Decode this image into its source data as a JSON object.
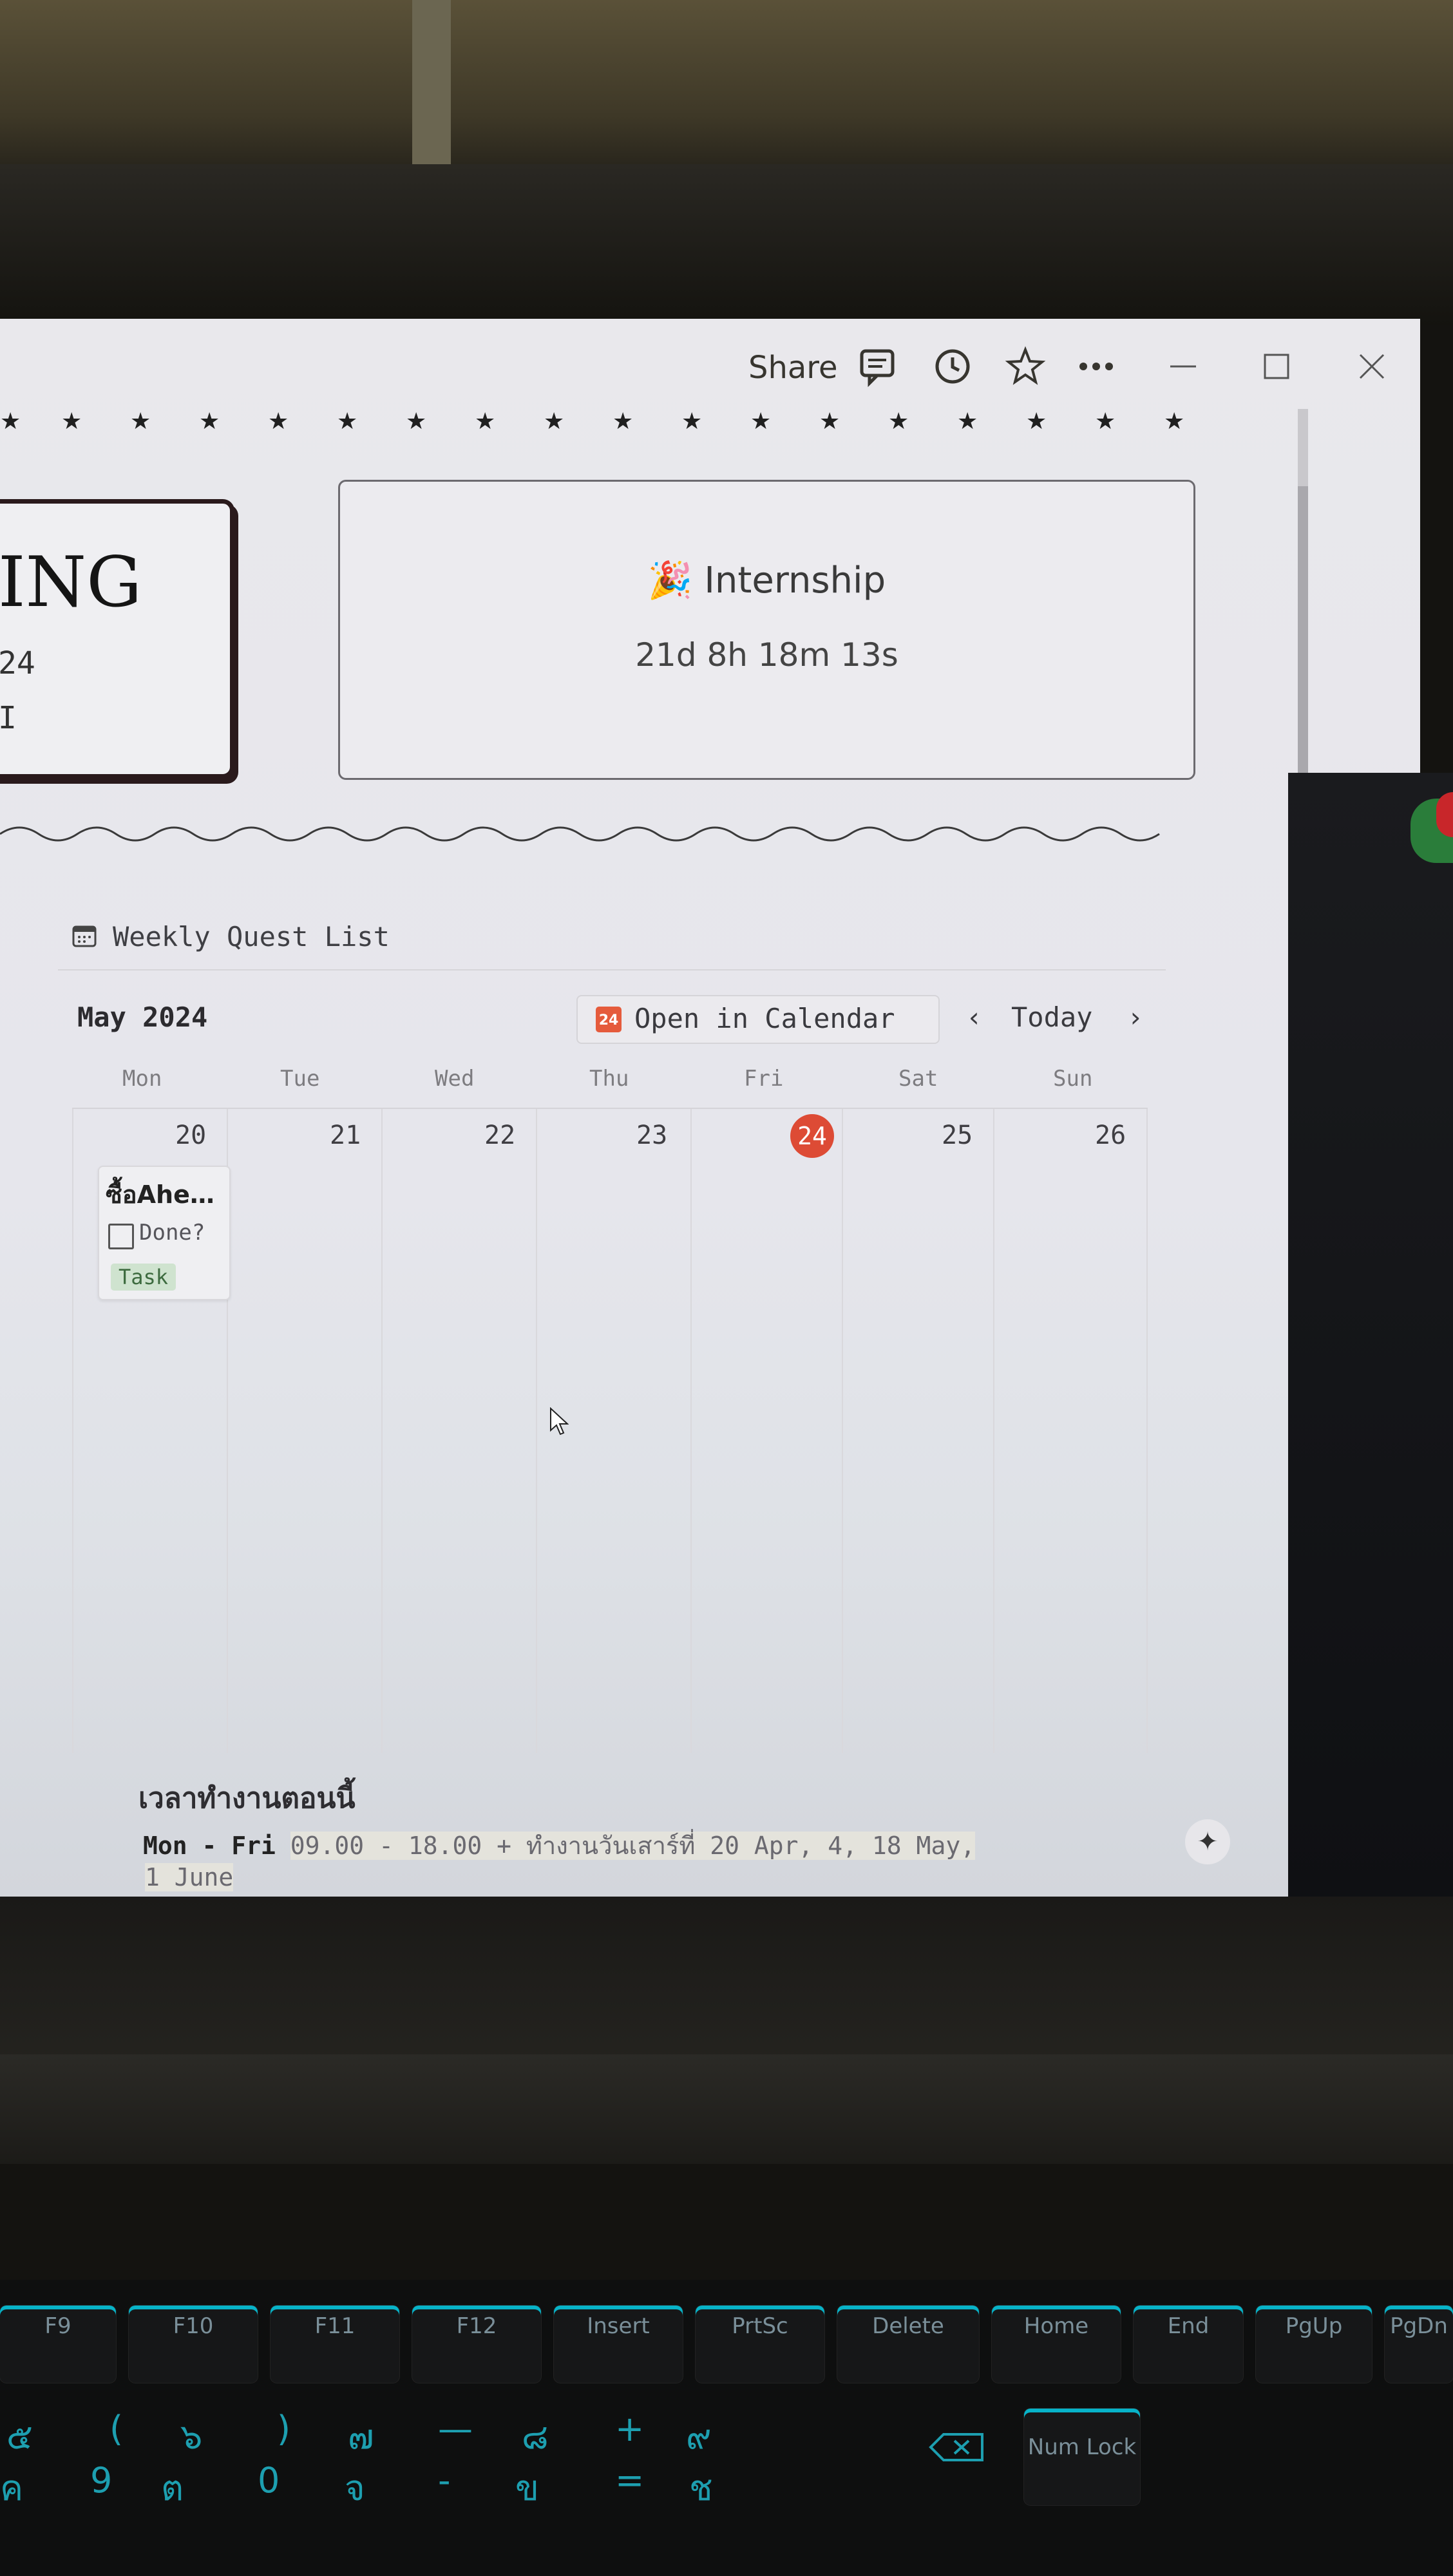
{
  "window": {
    "share_label": "Share"
  },
  "cards": {
    "left": {
      "title": "ING",
      "year_fragment": "24",
      "line3_fragment": "I"
    },
    "right": {
      "icon": "party-popper-icon",
      "title": "Internship",
      "countdown": "21d 8h 18m 13s"
    }
  },
  "section": {
    "title": "Weekly Quest List",
    "icon": "calendar-icon"
  },
  "calendar": {
    "month": "May 2024",
    "open_button": "Open in Calendar",
    "open_icon_text": "24",
    "today": "Today",
    "prev": "‹",
    "next": "›",
    "days": [
      "Mon",
      "Tue",
      "Wed",
      "Thu",
      "Fri",
      "Sat",
      "Sun"
    ],
    "dates": [
      "20",
      "21",
      "22",
      "23",
      "24",
      "25",
      "26"
    ],
    "today_date": "24",
    "task": {
      "title": "ซื้อAhe…",
      "checkbox_label": "Done?",
      "tag": "Task"
    }
  },
  "work_hours": {
    "title": "เวลาทำงานตอนนี้",
    "days": "Mon - Fri",
    "hours": "09.00 - 18.00 + ทำงานวันเสาร์ที่ 20 Apr, 4, 18 May,",
    "hours_cont": "1 June"
  },
  "ai_button": "✦",
  "keyboard": {
    "fkeys": [
      "F9",
      "F10",
      "F11",
      "F12",
      "Insert",
      "PrtSc",
      "Delete",
      "Home",
      "End",
      "PgUp",
      "PgDn"
    ],
    "numrow_top": [
      "๕",
      "(",
      "๖",
      ")",
      "๗",
      "—",
      "๘",
      "+",
      "๙"
    ],
    "numrow_bottom": [
      "ค",
      "9",
      "ต",
      "0",
      "จ",
      "-",
      "ข",
      "=",
      "ช"
    ],
    "numlock": "Num Lock"
  }
}
